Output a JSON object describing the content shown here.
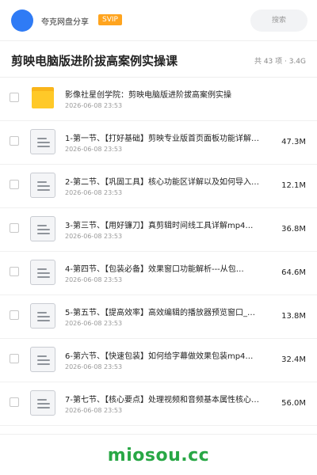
{
  "header": {
    "uploader": "夸克网盘分享",
    "badge": "SVIP",
    "search_placeholder": "搜索",
    "colors": {
      "avatar": "#2f7bf5",
      "badge": "#ffa41e"
    }
  },
  "share": {
    "title": "剪映电脑版进阶拔高案例实操课",
    "meta": "共 43 项 · 3.4G"
  },
  "files": [
    {
      "type": "folder",
      "icon": "folder-icon",
      "name": "影像社星创学院：剪映电脑版进阶拔高案例实操",
      "date": "2026-06-08 23:53",
      "size": ""
    },
    {
      "type": "file",
      "icon": "document-icon",
      "name": "1-第一节、【打好基础】剪映专业版首页面板功能详解…",
      "date": "2026-06-08 23:53",
      "size": "47.3M"
    },
    {
      "type": "file",
      "icon": "document-icon",
      "name": "2-第二节、【巩固工具】核心功能区详解以及如何导入…",
      "date": "2026-06-08 23:53",
      "size": "12.1M"
    },
    {
      "type": "file",
      "icon": "document-icon",
      "name": "3-第三节、【用好镰刀】真剪辑时间线工具详解mp4…",
      "date": "2026-06-08 23:53",
      "size": "36.8M"
    },
    {
      "type": "file",
      "icon": "document-icon",
      "name": "4-第四节、【包装必备】效果窗口功能解析---从包…",
      "date": "2026-06-08 23:53",
      "size": "64.6M"
    },
    {
      "type": "file",
      "icon": "document-icon",
      "name": "5-第五节、【提高效率】高效编辑的播放器预览窗口_…",
      "date": "2026-06-08 23:53",
      "size": "13.8M"
    },
    {
      "type": "file",
      "icon": "document-icon",
      "name": "6-第六节、【快速包装】如何给字幕做效果包装mp4…",
      "date": "2026-06-08 23:53",
      "size": "32.4M"
    },
    {
      "type": "file",
      "icon": "document-icon",
      "name": "7-第七节、【核心要点】处理视频和音频基本属性核心…",
      "date": "2026-06-08 23:53",
      "size": "56.0M"
    }
  ],
  "footer": {
    "brand": "miosou.cc",
    "color": "#28a745"
  }
}
